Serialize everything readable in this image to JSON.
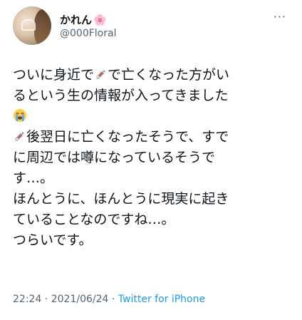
{
  "author": {
    "display_name": "かれん",
    "name_emoji": "🌸",
    "handle": "@000Floral",
    "avatar_icon": "profile-photo-icon"
  },
  "menu": {
    "more_label": "···"
  },
  "tweet": {
    "line1": "ついに身近で",
    "line1b": "で亡くなった方がい",
    "line2": "るという生の情報が入ってきました",
    "line4": "後翌日に亡くなったそうで、すで",
    "line5": "に周辺では噂になっているそうで",
    "line6": "す…。",
    "line7": "ほんとうに、ほんとうに現実に起き",
    "line8": "ていることなのですね…。",
    "line9": "つらいです。",
    "syringe_icon": "syringe-icon",
    "crying_icon": "loudly-crying-face-icon"
  },
  "meta": {
    "time": "22:24",
    "date": "2021/06/24",
    "source": "Twitter for iPhone",
    "separator": " · "
  },
  "colors": {
    "text": "#0f1419",
    "secondary": "#536471",
    "link": "#1d9bf0"
  }
}
